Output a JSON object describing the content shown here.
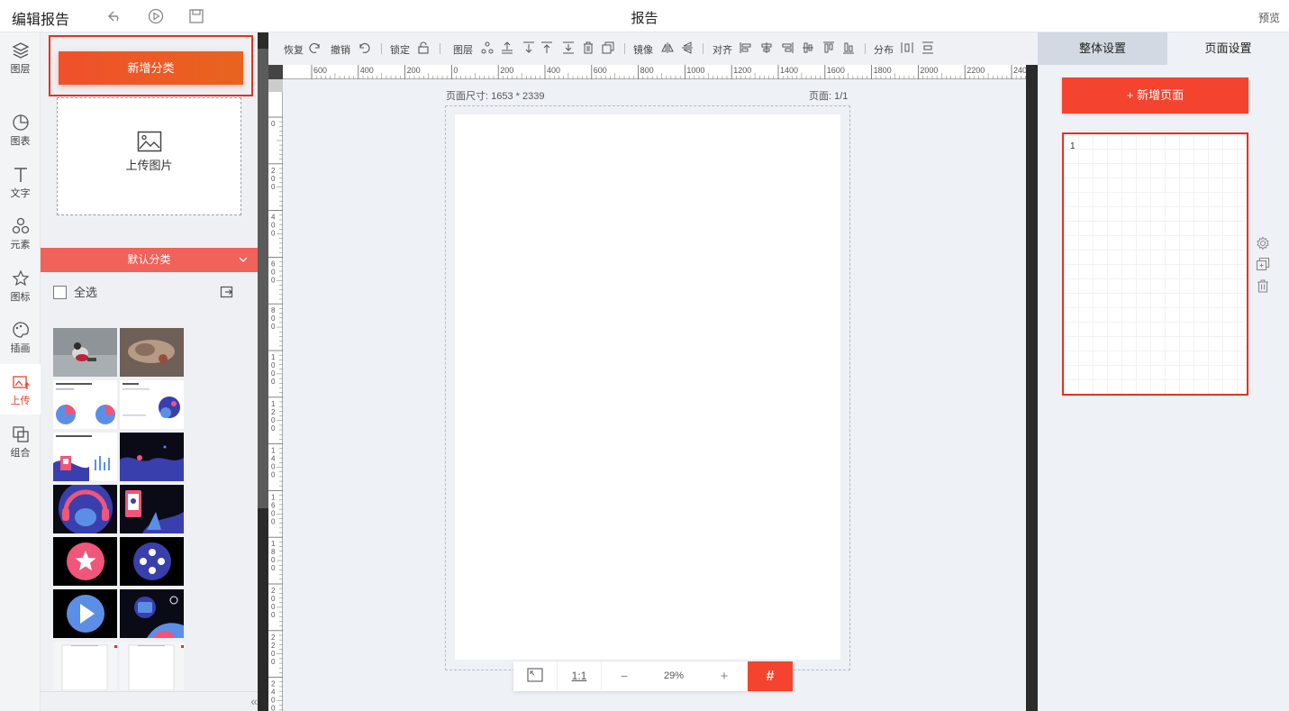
{
  "header": {
    "title": "编辑报告",
    "center_title": "报告",
    "preview_label": "预览"
  },
  "rail": {
    "items": [
      {
        "label": "图层",
        "icon": "layers-icon"
      },
      {
        "label": "图表",
        "icon": "chart-pie-icon"
      },
      {
        "label": "文字",
        "icon": "text-icon"
      },
      {
        "label": "元素",
        "icon": "shapes-icon"
      },
      {
        "label": "图标",
        "icon": "star-icon"
      },
      {
        "label": "插画",
        "icon": "palette-icon"
      },
      {
        "label": "上传",
        "icon": "upload-image-icon",
        "active": true
      },
      {
        "label": "组合",
        "icon": "group-icon"
      }
    ]
  },
  "left_panel": {
    "add_category_label": "新增分类",
    "upload_label": "上传图片",
    "category_name": "默认分类",
    "select_all_label": "全选",
    "thumbnails": [
      {
        "kind": "photo-dog"
      },
      {
        "kind": "photo-cat"
      },
      {
        "kind": "report-pie-charts"
      },
      {
        "kind": "illustration-blob"
      },
      {
        "kind": "report-bars"
      },
      {
        "kind": "illustration-wave"
      },
      {
        "kind": "illustration-headphones"
      },
      {
        "kind": "illustration-phone"
      },
      {
        "kind": "star-circle"
      },
      {
        "kind": "dots-circle"
      },
      {
        "kind": "play-circle"
      },
      {
        "kind": "illustration-astronaut"
      },
      {
        "kind": "blank-page"
      },
      {
        "kind": "blank-page"
      }
    ]
  },
  "toolbar": {
    "redo_label": "恢复",
    "undo_label": "撤销",
    "lock_label": "锁定",
    "layer_label": "图层",
    "mirror_label": "镜像",
    "align_label": "对齐",
    "distribute_label": "分布"
  },
  "canvas": {
    "size_label": "页面尺寸: 1653 * 2339",
    "page_label": "页面: 1/1",
    "ruler_labels": [
      "600",
      "400",
      "200",
      "0",
      "200",
      "400",
      "600",
      "800",
      "1000",
      "1200",
      "1400",
      "1600",
      "1800",
      "2000",
      "2200",
      "2400"
    ],
    "vruler_labels": [
      "0",
      "200",
      "400",
      "600",
      "800",
      "1000",
      "1200",
      "1400",
      "1600",
      "1800",
      "2000",
      "2200",
      "2400"
    ],
    "zoom_fit_label": "fit",
    "zoom_one_label": "1:1",
    "zoom_minus": "−",
    "zoom_value": "29%",
    "zoom_plus": "+",
    "grid_icon": "#"
  },
  "right_panel": {
    "tab_global": "整体设置",
    "tab_page": "页面设置",
    "add_page_label": "+ 新增页面",
    "page_number": "1"
  },
  "colors": {
    "accent": "#f4432e",
    "category_bar": "#f0625a",
    "active_rail": "#e8452f"
  }
}
